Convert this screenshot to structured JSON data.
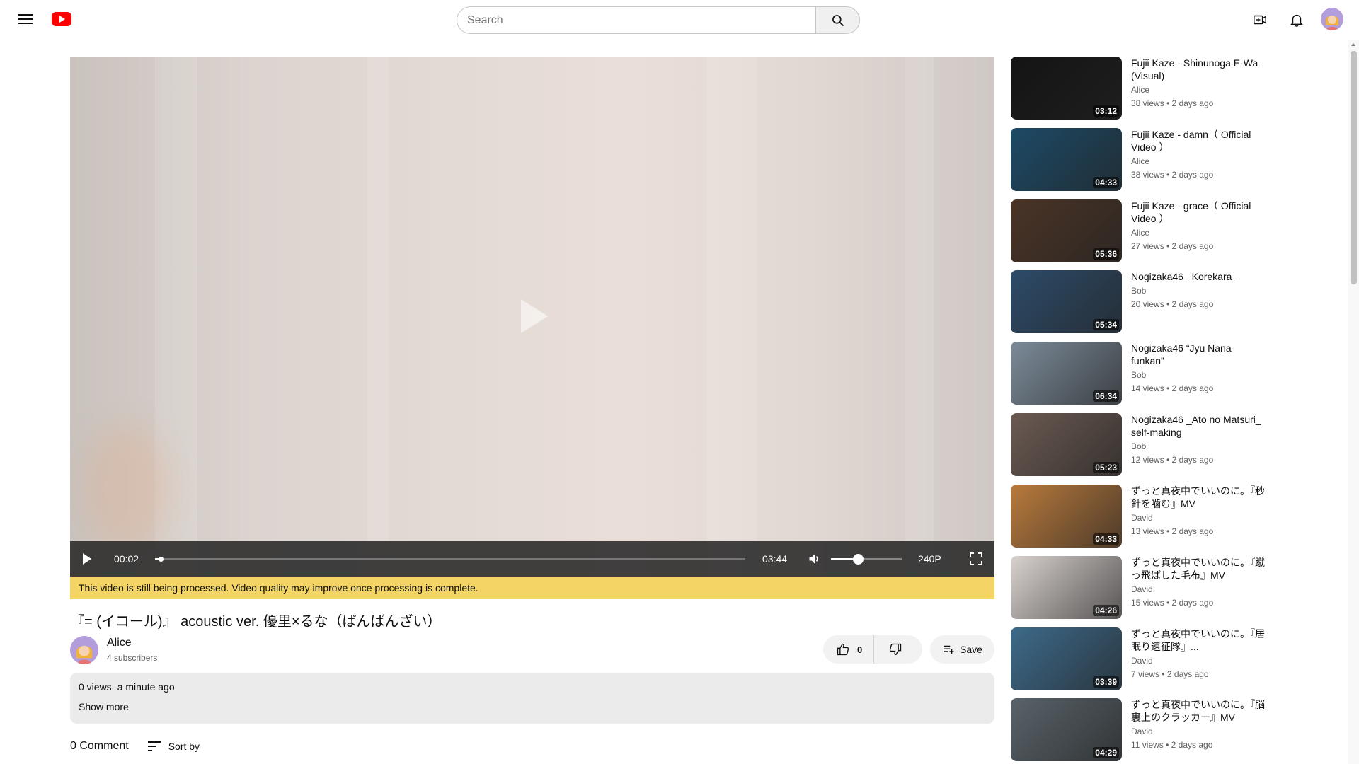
{
  "search": {
    "placeholder": "Search"
  },
  "player": {
    "current_time": "00:02",
    "duration": "03:44",
    "quality": "240P",
    "progress_fraction": 0.009,
    "volume_fraction": 0.38
  },
  "processing_notice": "This video is still being processed. Video quality may improve once processing is complete.",
  "video": {
    "title": "『= (イコール)』 acoustic ver. 優里×るな（ばんばんざい）",
    "channel": "Alice",
    "subscribers": "4 subscribers",
    "likes": "0",
    "save_label": "Save",
    "views": "0 views",
    "posted": "a minute ago",
    "show_more": "Show more"
  },
  "comments": {
    "count_label": "0 Comment",
    "sort_label": "Sort by"
  },
  "recommendations": [
    {
      "title": "Fujii Kaze - Shinunoga E-Wa (Visual)",
      "channel": "Alice",
      "meta": "38 views • 2 days ago",
      "duration": "03:12",
      "thumb_color": "#141414"
    },
    {
      "title": "Fujii Kaze - damn（ Official Video ）",
      "channel": "Alice",
      "meta": "38 views • 2 days ago",
      "duration": "04:33",
      "thumb_color": "#1d4a66"
    },
    {
      "title": "Fujii Kaze - grace（ Official Video ）",
      "channel": "Alice",
      "meta": "27 views • 2 days ago",
      "duration": "05:36",
      "thumb_color": "#4a3426"
    },
    {
      "title": "Nogizaka46 _Korekara_",
      "channel": "Bob",
      "meta": "20 views • 2 days ago",
      "duration": "05:34",
      "thumb_color": "#2d4b69"
    },
    {
      "title": "Nogizaka46 “Jyu Nana-funkan”",
      "channel": "Bob",
      "meta": "14 views • 2 days ago",
      "duration": "06:34",
      "thumb_color": "#7c8b99"
    },
    {
      "title": "Nogizaka46 _Ato no Matsuri_ self-making",
      "channel": "Bob",
      "meta": "12 views • 2 days ago",
      "duration": "05:23",
      "thumb_color": "#6b5a52"
    },
    {
      "title": "ずっと真夜中でいいのに。『秒針を噛む』MV",
      "channel": "David",
      "meta": "13 views • 2 days ago",
      "duration": "04:33",
      "thumb_color": "#b97a3c"
    },
    {
      "title": "ずっと真夜中でいいのに。『蹴っ飛ばした毛布』MV",
      "channel": "David",
      "meta": "15 views • 2 days ago",
      "duration": "04:26",
      "thumb_color": "#d9d2cf"
    },
    {
      "title": "ずっと真夜中でいいのに。『居眠り遠征隊』...",
      "channel": "David",
      "meta": "7 views • 2 days ago",
      "duration": "03:39",
      "thumb_color": "#3d6a8a"
    },
    {
      "title": "ずっと真夜中でいいのに。『脳裏上のクラッカー』MV",
      "channel": "David",
      "meta": "11 views • 2 days ago",
      "duration": "04:29",
      "thumb_color": "#59636a"
    }
  ]
}
